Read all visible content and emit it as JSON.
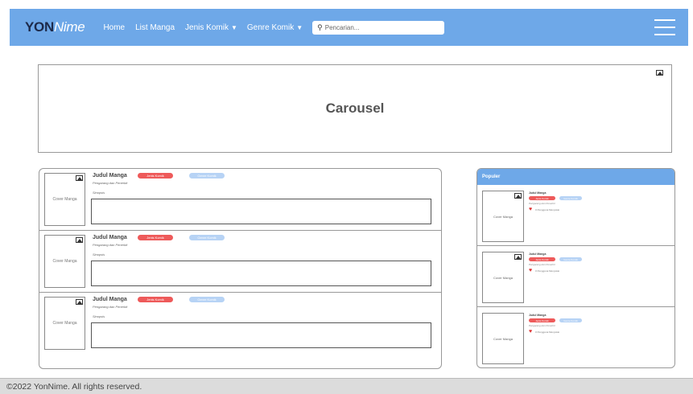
{
  "navbar": {
    "brand_bold": "YON",
    "brand_rest": "Nime",
    "links": [
      "Home",
      "List Manga"
    ],
    "dropdowns": [
      "Jenis Komik",
      "Genre Komik"
    ],
    "search_placeholder": "Pencarian..."
  },
  "carousel": {
    "title": "Carousel"
  },
  "manga_list": [
    {
      "cover": "Cover Manga",
      "title": "Judul Manga",
      "badge_type": "Jenis Komik",
      "badge_genre": "Genre Komik",
      "author": "Pengarang dan Penerbit",
      "synopsis_label": "Sinopsis"
    },
    {
      "cover": "Cover Manga",
      "title": "Judul Manga",
      "badge_type": "Jenis Komik",
      "badge_genre": "Genre Komik",
      "author": "Pengarang dan Penerbit",
      "synopsis_label": "Sinopsis"
    },
    {
      "cover": "Cover Manga",
      "title": "Judul Manga",
      "badge_type": "Jenis Komik",
      "badge_genre": "Genre Komik",
      "author": "Pengarang dan Penerbit",
      "synopsis_label": "Sinopsis"
    }
  ],
  "popular": {
    "header": "Populer",
    "items": [
      {
        "cover": "Cover Manga",
        "title": "Judul Manga",
        "badge_type": "Jenis Komik",
        "badge_genre": "Genre Komik",
        "author": "Pengarang dan Penerbit",
        "likes": "0 Pengguna Menyukai"
      },
      {
        "cover": "Cover Manga",
        "title": "Judul Manga",
        "badge_type": "Jenis Komik",
        "badge_genre": "Genre Komik",
        "author": "Pengarang dan Penerbit",
        "likes": "0 Pengguna Menyukai"
      },
      {
        "cover": "Cover Manga",
        "title": "Judul Manga",
        "badge_type": "Jenis Komik",
        "badge_genre": "Genre Komik",
        "author": "Pengarang dan Penerbit",
        "likes": "0 Pengguna Menyukai"
      }
    ]
  },
  "footer": {
    "text": "©2022 YonNime. All rights reserved."
  },
  "colors": {
    "navbar": "#6ea8e8",
    "badge_type": "#ee5a5a",
    "badge_genre": "#b7d3f5",
    "footer": "#dcdcdc"
  }
}
